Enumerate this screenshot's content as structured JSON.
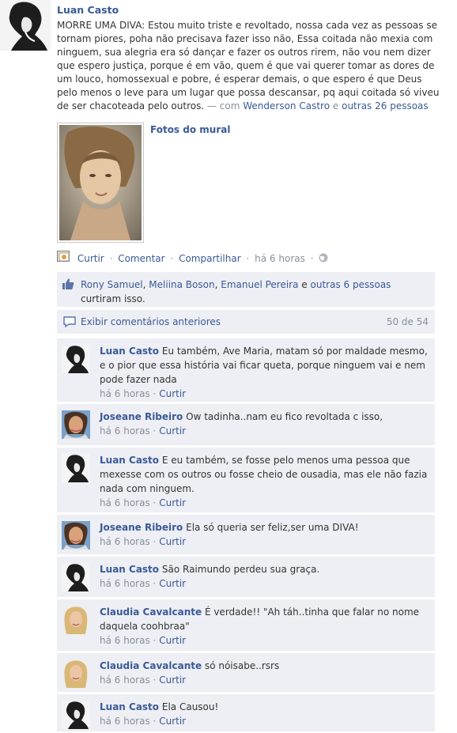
{
  "post": {
    "author": "Luan Casto",
    "text": "MORRE UMA DIVA: Estou muito triste e revoltado, nossa cada vez as pessoas se tornam piores, poha não precisava fazer isso não, Essa coitada não mexia com ninguem, sua alegria era só dançar e fazer os outros rirem, não vou nem dizer que espero justiça, porque é em vão, quem é que vai querer tomar as dores de um louco, homossexual e pobre, é esperar demais, o que espero é que Deus pelo menos o leve para um lugar que possa descansar, pq aqui coitada só viveu de ser chacoteada pelo outros.",
    "with_prefix": "— com",
    "with_person": "Wenderson Castro",
    "with_and": "e",
    "with_others": "outras 26 pessoas",
    "photo_label": "Fotos do mural"
  },
  "actions": {
    "like": "Curtir",
    "comment": "Comentar",
    "share": "Compartilhar",
    "time": "há 6 horas",
    "separator": "·"
  },
  "likes": {
    "names": [
      "Rony Samuel",
      "Meliina Boson",
      "Emanuel Pereira"
    ],
    "and": "e",
    "others": "outras 6 pessoas",
    "suffix": "curtiram isso."
  },
  "previous": {
    "label": "Exibir comentários anteriores",
    "count": "50 de 54"
  },
  "comment_meta": {
    "time": "há 6 horas",
    "separator": "·",
    "like": "Curtir"
  },
  "comments": [
    {
      "author": "Luan Casto",
      "text": "Eu também, Ave Maria, matam só por maldade mesmo, e o pior que essa história vai ficar queta, porque ninguem vai e nem pode fazer nada",
      "avatar": "luan"
    },
    {
      "author": "Joseane Ribeiro",
      "text": "Ow tadinha..nam eu fico revoltada c isso,",
      "avatar": "joseane"
    },
    {
      "author": "Luan Casto",
      "text": "E eu também, se fosse pelo menos uma pessoa que mexesse com os outros ou fosse cheio de ousadia, mas ele não fazia nada com ninguem.",
      "avatar": "luan"
    },
    {
      "author": "Joseane Ribeiro",
      "text": "Ela só queria ser feliz,ser uma DIVA!",
      "avatar": "joseane"
    },
    {
      "author": "Luan Casto",
      "text": "São Raimundo perdeu sua graça.",
      "avatar": "luan"
    },
    {
      "author": "Claudia Cavalcante",
      "text": "É verdade!! \"Ah táh..tinha que falar no nome daquela coohbraa\"",
      "avatar": "claudia"
    },
    {
      "author": "Claudia Cavalcante",
      "text": "só nóisabe..rsrs",
      "avatar": "claudia"
    },
    {
      "author": "Luan Casto",
      "text": "Ela Causou!",
      "avatar": "luan"
    }
  ],
  "colors": {
    "link": "#3b5998",
    "ufi_background": "#edeff4",
    "meta_grey": "#8a8f9a"
  }
}
